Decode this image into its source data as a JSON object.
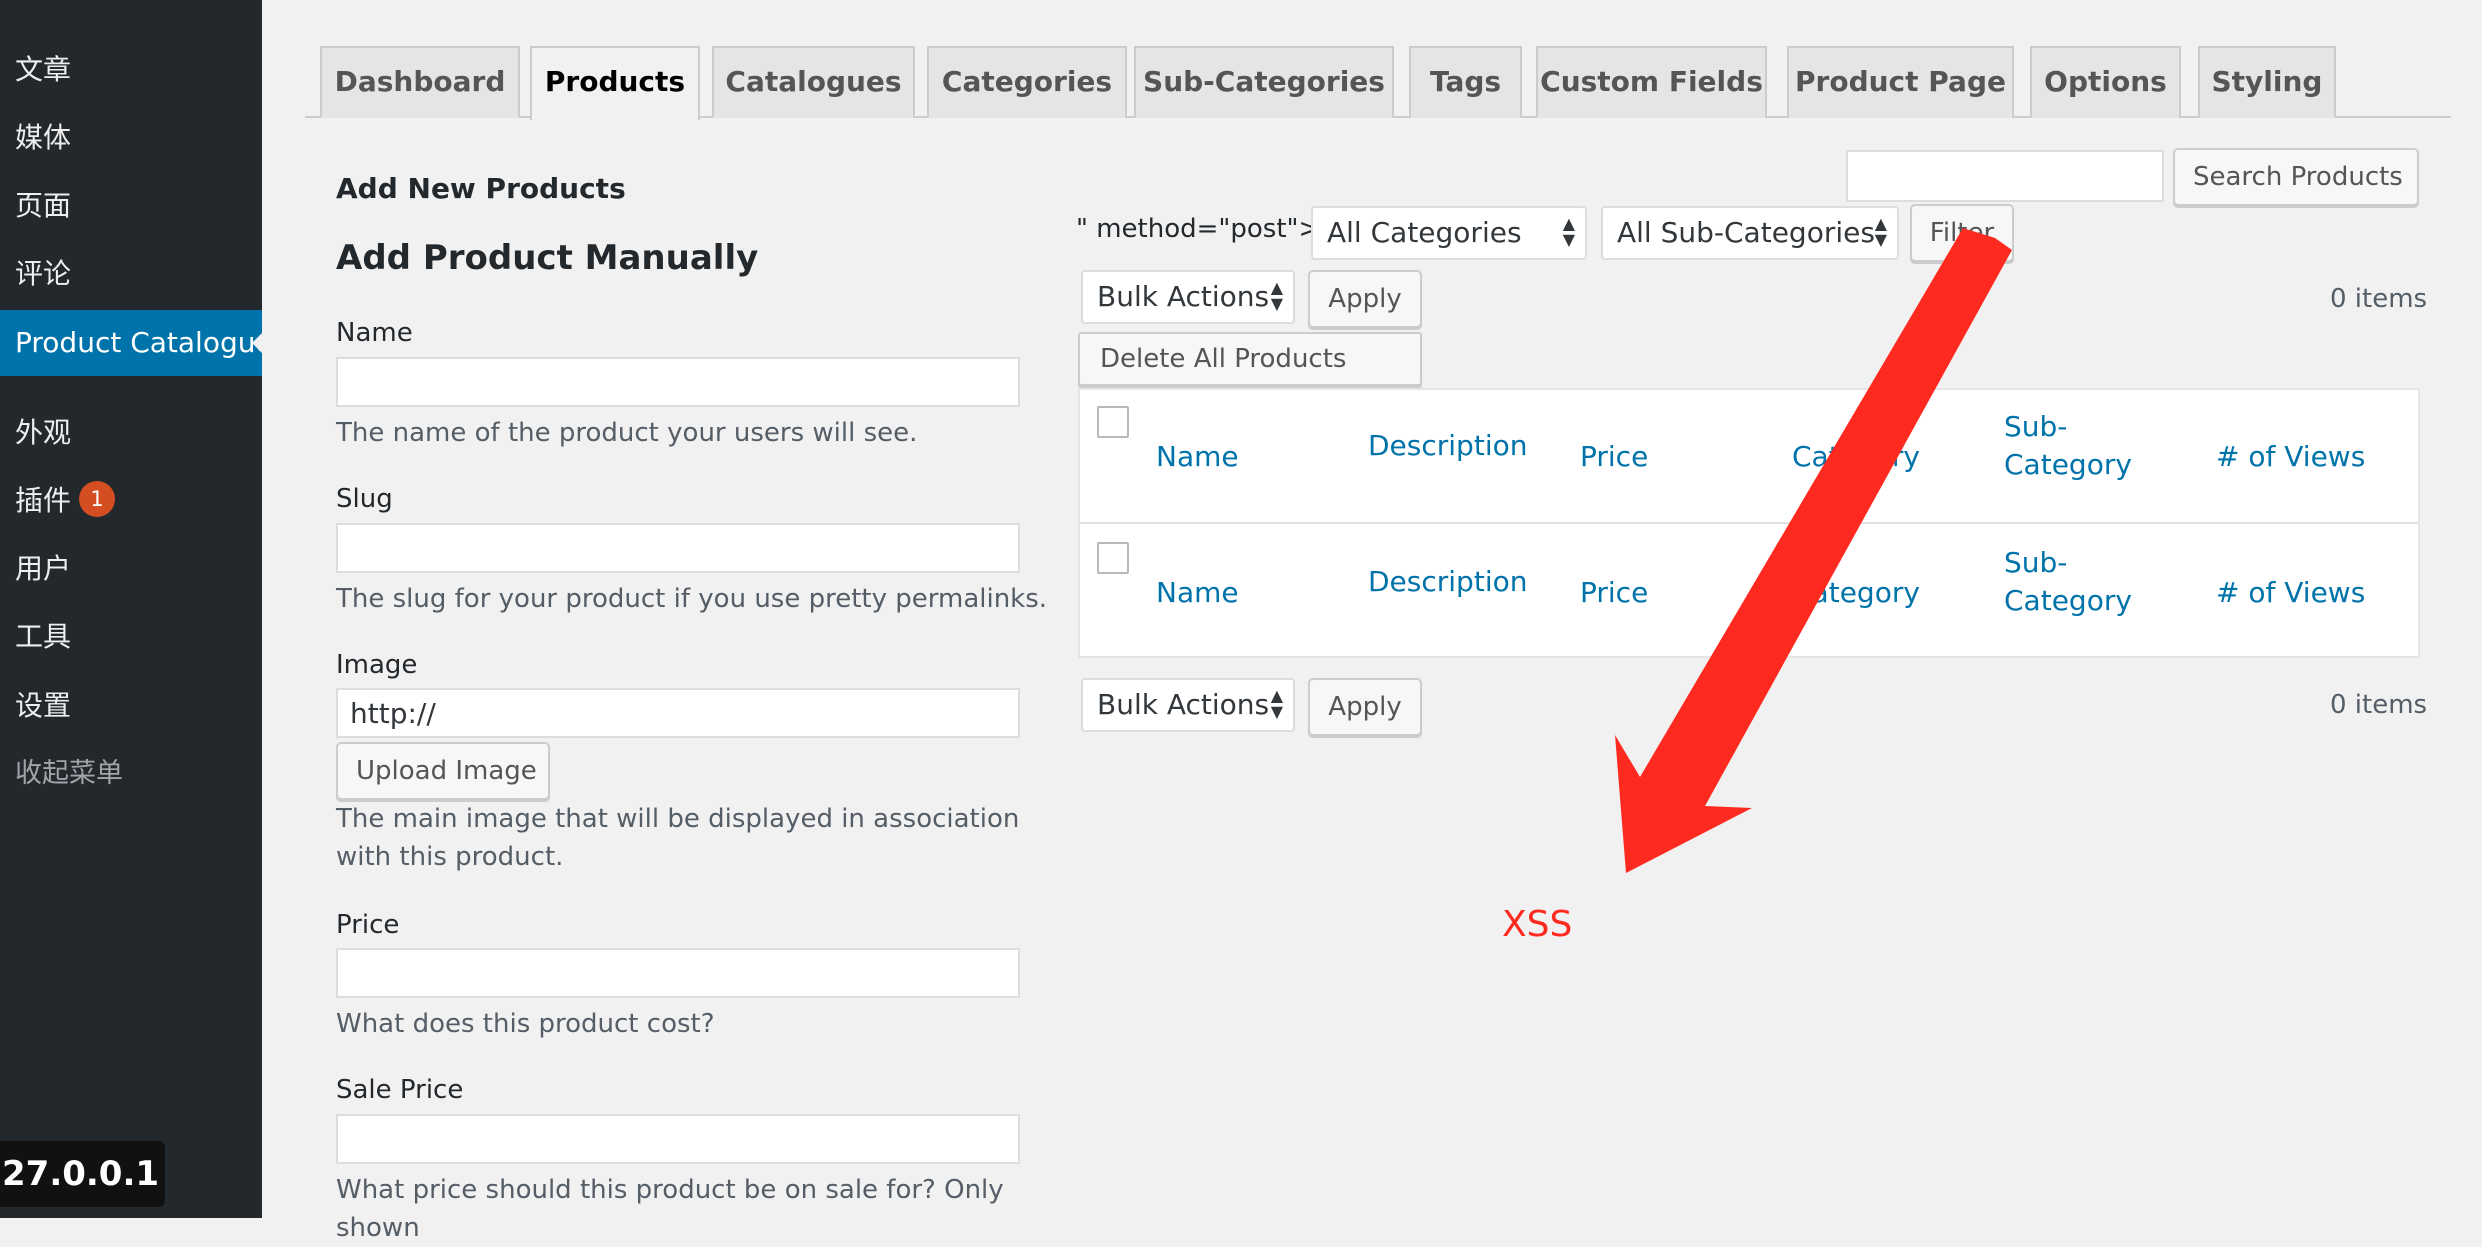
{
  "sidebar": {
    "items": [
      {
        "label": "文章"
      },
      {
        "label": "媒体"
      },
      {
        "label": "页面"
      },
      {
        "label": "评论"
      },
      {
        "label": "Product Catalogue"
      },
      {
        "label": "外观"
      },
      {
        "label": "插件",
        "badge": "1"
      },
      {
        "label": "用户"
      },
      {
        "label": "工具"
      },
      {
        "label": "设置"
      },
      {
        "label": "收起菜单"
      }
    ],
    "host": "27.0.0.1"
  },
  "tabs": [
    "Dashboard",
    "Products",
    "Catalogues",
    "Categories",
    "Sub-Categories",
    "Tags",
    "Custom Fields",
    "Product Page",
    "Options",
    "Styling"
  ],
  "active_tab": "Products",
  "form": {
    "section_title": "Add New Products",
    "manual_title": "Add Product Manually",
    "name_label": "Name",
    "name_desc": "The name of the product your users will see.",
    "slug_label": "Slug",
    "slug_desc": "The slug for your product if you use pretty permalinks.",
    "image_label": "Image",
    "image_value": "http://",
    "upload_button": "Upload Image",
    "image_desc": "The main image that will be displayed in association with this product.",
    "price_label": "Price",
    "price_desc": "What does this product cost?",
    "sale_label": "Sale Price",
    "sale_desc": "What price should this product be on sale for? Only shown"
  },
  "list": {
    "search_button": "Search Products",
    "method_text": "\" method=\"post\">",
    "category_select": "All Categories",
    "subcategory_select": "All Sub-Categories",
    "filter_button": "Filter",
    "bulk_select": "Bulk Actions",
    "apply_button": "Apply",
    "items_count": "0 items",
    "delete_all_button": "Delete All Products",
    "columns": [
      "Name",
      "Description",
      "Price",
      "Category",
      "Sub-\nCategory",
      "# of Views"
    ]
  },
  "annotation": {
    "label": "XSS",
    "color": "#ff2a1f"
  },
  "colors": {
    "sidebar_bg": "#23282d",
    "accent": "#0073aa",
    "badge": "#d54e21",
    "page_bg": "#f1f1f1"
  }
}
